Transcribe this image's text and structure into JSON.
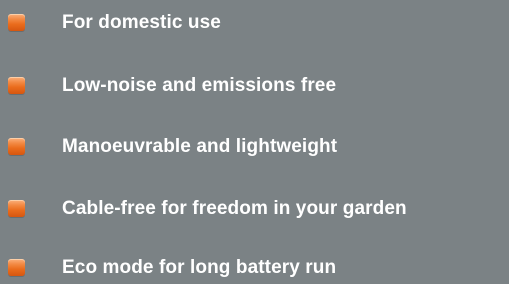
{
  "colors": {
    "background": "#7b8285",
    "bullet": "#ea6c1c",
    "text": "#ffffff"
  },
  "features": [
    {
      "icon": "orange-square-bullet-icon",
      "text": "For domestic use"
    },
    {
      "icon": "orange-square-bullet-icon",
      "text": "Low-noise and emissions free"
    },
    {
      "icon": "orange-square-bullet-icon",
      "text": "Manoeuvrable and lightweight"
    },
    {
      "icon": "orange-square-bullet-icon",
      "text": "Cable-free for freedom in your garden"
    },
    {
      "icon": "orange-square-bullet-icon",
      "text": "Eco mode for long battery run"
    }
  ]
}
